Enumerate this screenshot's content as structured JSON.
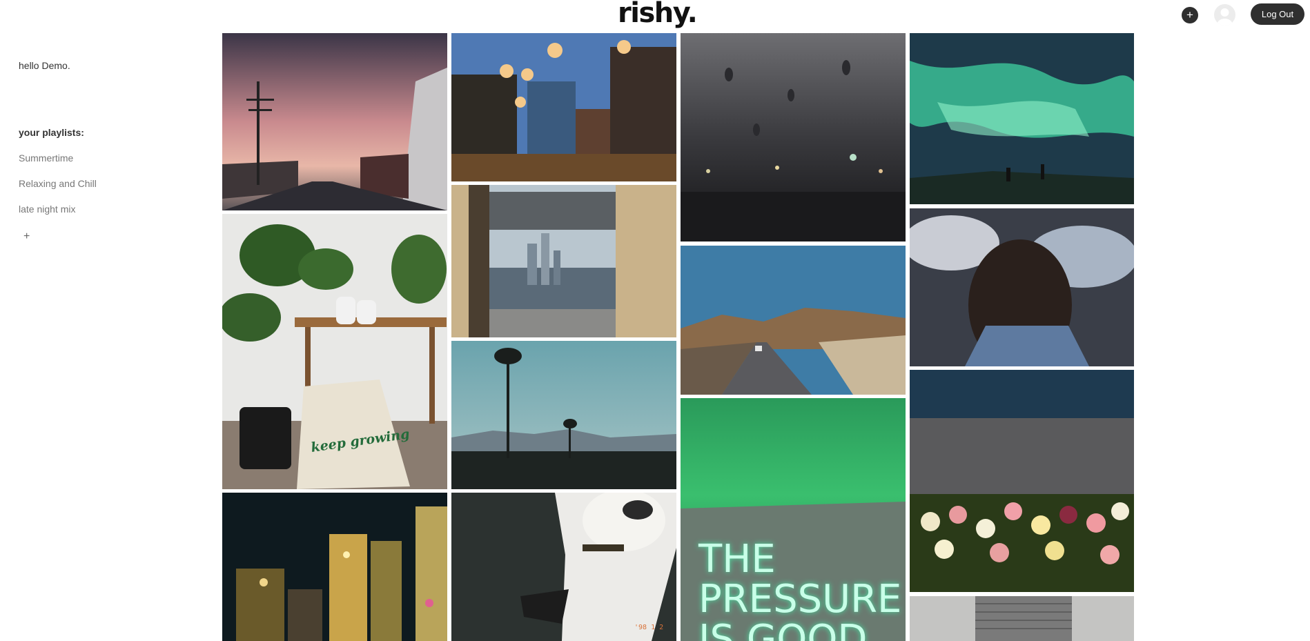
{
  "header": {
    "logo": "rishy.",
    "add_label": "+",
    "avatar_icon": "user-avatar-icon",
    "logout_label": "Log Out"
  },
  "sidebar": {
    "greeting": "hello Demo.",
    "playlists_heading": "your playlists:",
    "playlists": [
      {
        "label": "Summertime"
      },
      {
        "label": "Relaxing and Chill"
      },
      {
        "label": "late night mix"
      }
    ],
    "add_label": "+"
  },
  "gallery": {
    "tiles": [
      {
        "name": "tile-street-sunset",
        "description_icon": "photo-street-sunset"
      },
      {
        "name": "tile-lantern-street",
        "description_icon": "photo-lantern-street"
      },
      {
        "name": "tile-rainy-window",
        "description_icon": "photo-rainy-window"
      },
      {
        "name": "tile-aurora",
        "description_icon": "photo-aurora"
      },
      {
        "name": "tile-plant-sneakers",
        "description_icon": "photo-plant-sneakers",
        "tote_text": "keep growing"
      },
      {
        "name": "tile-window-city",
        "description_icon": "photo-window-city"
      },
      {
        "name": "tile-coastal-highway",
        "description_icon": "photo-coastal-highway"
      },
      {
        "name": "tile-umbrella-crowd",
        "description_icon": "photo-umbrella-crowd"
      },
      {
        "name": "tile-palm-hills",
        "description_icon": "photo-palm-hills"
      },
      {
        "name": "tile-neon-sign",
        "description_icon": "photo-neon-sign",
        "neon_lines": [
          "THE",
          "PRESSURE",
          "IS GOOD"
        ]
      },
      {
        "name": "tile-tulips-street",
        "description_icon": "photo-tulips-street"
      },
      {
        "name": "tile-city-night-blur",
        "description_icon": "photo-city-night-blur"
      },
      {
        "name": "tile-dog",
        "description_icon": "photo-dog",
        "date_stamp": "'98 1 2"
      },
      {
        "name": "tile-garage-door",
        "description_icon": "photo-garage-door"
      }
    ]
  },
  "colors": {
    "button_dark": "#2f2f2f",
    "neon_green": "#48e3a4"
  }
}
